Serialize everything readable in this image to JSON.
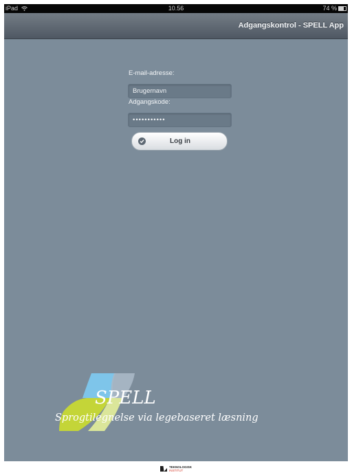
{
  "status_bar": {
    "device": "iPad",
    "time": "10.56",
    "battery": "74 %",
    "wifi_icon": "wifi-icon"
  },
  "nav_bar": {
    "title": "Adgangskontrol - SPELL App"
  },
  "login_form": {
    "email_label": "E-mail-adresse:",
    "email_value": "Brugernavn",
    "password_label": "Adgangskode:",
    "password_value": "•••••••••••",
    "login_button_label": "Log in",
    "button_icon": "check-circle-icon"
  },
  "branding": {
    "title": "SPELL",
    "subtitle": "Sprogtilegnelse via legebaseret læsning",
    "colors": {
      "blue": "#7ec8ee",
      "green": "#c8d933",
      "gray": "#aab8c6"
    }
  },
  "footer": {
    "line1": "TEKNOLOGISK",
    "line2": "INSTITUT"
  }
}
